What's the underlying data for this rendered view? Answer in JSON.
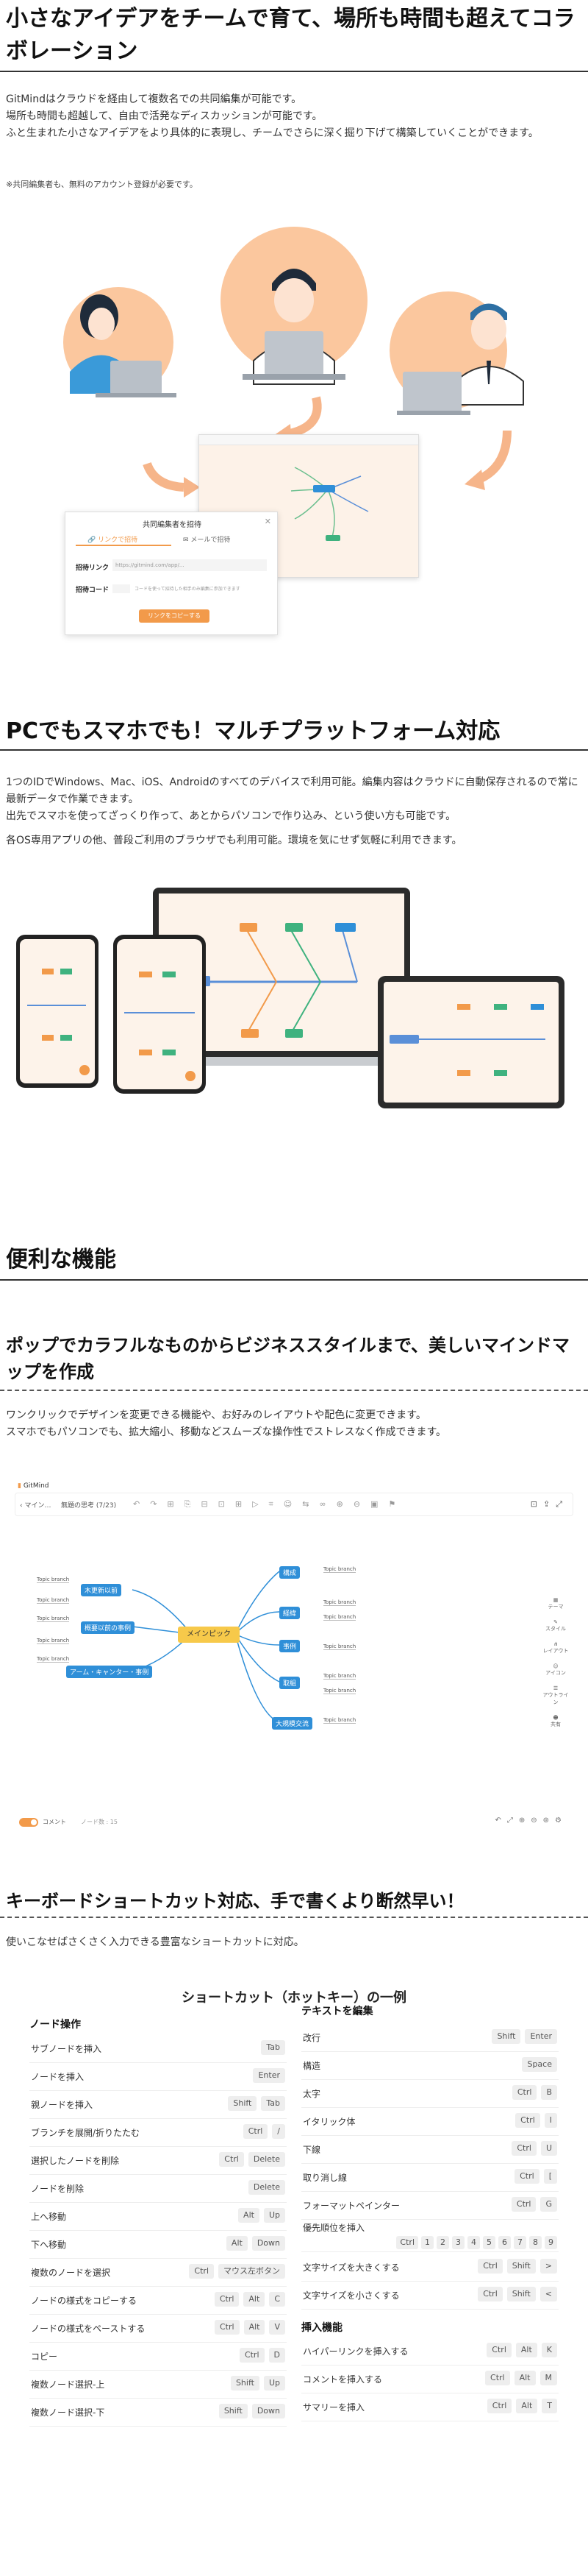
{
  "section1": {
    "title": "小さなアイデアをチームで育て、場所も時間も超えてコラボレーション",
    "paragraph": [
      "GitMindはクラウドを経由して複数名での共同編集が可能です。",
      "場所も時間も超越して、自由で活発なディスカッションが可能です。",
      "ふと生まれた小さなアイデアをより具体的に表現し、チームでさらに深く掘り下げて構築していくことができます。"
    ],
    "note": "※共同編集者も、無料のアカウント登録が必要です。",
    "invite_dialog": {
      "title": "共同編集者を招待",
      "tab_link": "リンクで招待",
      "tab_email": "メールで招待",
      "link_label": "招待リンク",
      "link_value": "https://gitmind.com/app/...",
      "code_label": "招待コード",
      "code_hint": "コードを使って招待した相手のみ編集に参加できます",
      "copy_button": "リンクをコピーする"
    }
  },
  "section2": {
    "title": "PCでもスマホでも！マルチプラットフォーム対応",
    "paragraph": [
      "1つのIDでWindows、Mac、iOS、Androidのすべてのデバイスで利用可能。編集内容はクラウドに自動保存されるので常に最新データで作業できます。",
      "出先でスマホを使ってざっくり作って、あとからパソコンで作り込み、という使い方も可能です。",
      "各OS専用アプリの他、普段ご利用のブラウザでも利用可能。環境を気にせず気軽に利用できます。"
    ]
  },
  "section3": {
    "title": "便利な機能"
  },
  "feature1": {
    "title": "ポップでカラフルなものからビジネススタイルまで、美しいマインドマップを作成",
    "paragraph": [
      "ワンクリックでデザインを変更できる機能や、お好みのレイアウトや配色に変更できます。",
      "スマホでもパソコンでも、拡大縮小、移動などスムーズな操作性でストレスなく作成できます。"
    ],
    "app": {
      "brand": "GitMind",
      "back": "マイン…",
      "doc_title": "無題の思考 (7/23)",
      "center_topic": "メインピック",
      "toggle_label": "コメント",
      "node_count": "ノード数 : 15",
      "right_tools": [
        "テーマ",
        "スタイル",
        "レイアウト",
        "アイコン",
        "アウトライン",
        "共有"
      ],
      "left_nodes": [
        "木更新以前",
        "概要以前の事例",
        "アーム・キャンター・事例"
      ],
      "right_nodes": [
        "構成",
        "経緯",
        "事例",
        "取組",
        "大規模交流"
      ],
      "topic_label": "Topic branch"
    }
  },
  "feature2": {
    "title": "キーボードショートカット対応、手で書くより断然早い！",
    "paragraph": "使いこなせばさくさく入力できる豊富なショートカットに対応。",
    "table_title": "ショートカット（ホットキー）の一例",
    "left_category": "ノード操作",
    "left_rows": [
      {
        "label": "サブノードを挿入",
        "keys": [
          "Tab"
        ]
      },
      {
        "label": "ノードを挿入",
        "keys": [
          "Enter"
        ]
      },
      {
        "label": "親ノードを挿入",
        "keys": [
          "Shift",
          "Tab"
        ]
      },
      {
        "label": "ブランチを展開/折りたたむ",
        "keys": [
          "Ctrl",
          "/"
        ]
      },
      {
        "label": "選択したノードを削除",
        "keys": [
          "Ctrl",
          "Delete"
        ]
      },
      {
        "label": "ノードを削除",
        "keys": [
          "Delete"
        ]
      },
      {
        "label": "上へ移動",
        "keys": [
          "Alt",
          "Up"
        ]
      },
      {
        "label": "下へ移動",
        "keys": [
          "Alt",
          "Down"
        ]
      },
      {
        "label": "複数のノードを選択",
        "keys": [
          "Ctrl",
          "マウス左ボタン"
        ]
      },
      {
        "label": "ノードの様式をコピーする",
        "keys": [
          "Ctrl",
          "Alt",
          "C"
        ]
      },
      {
        "label": "ノードの様式をペーストする",
        "keys": [
          "Ctrl",
          "Alt",
          "V"
        ]
      },
      {
        "label": "コピー",
        "keys": [
          "Ctrl",
          "D"
        ]
      },
      {
        "label": "複数ノード選択-上",
        "keys": [
          "Shift",
          "Up"
        ]
      },
      {
        "label": "複数ノード選択-下",
        "keys": [
          "Shift",
          "Down"
        ]
      }
    ],
    "right_category": "テキストを編集",
    "right_rows": [
      {
        "label": "改行",
        "keys": [
          "Shift",
          "Enter"
        ]
      },
      {
        "label": "構造",
        "keys": [
          "Space"
        ]
      },
      {
        "label": "太字",
        "keys": [
          "Ctrl",
          "B"
        ]
      },
      {
        "label": "イタリック体",
        "keys": [
          "Ctrl",
          "I"
        ]
      },
      {
        "label": "下線",
        "keys": [
          "Ctrl",
          "U"
        ]
      },
      {
        "label": "取り消し線",
        "keys": [
          "Ctrl",
          "["
        ]
      },
      {
        "label": "フォーマットペインター",
        "keys": [
          "Ctrl",
          "G"
        ]
      }
    ],
    "priority_label": "優先順位を挿入",
    "priority_keys": [
      "Ctrl",
      "1",
      "2",
      "3",
      "4",
      "5",
      "6",
      "7",
      "8",
      "9"
    ],
    "right_rows2": [
      {
        "label": "文字サイズを大きくする",
        "keys": [
          "Ctrl",
          "Shift",
          ">"
        ]
      },
      {
        "label": "文字サイズを小さくする",
        "keys": [
          "Ctrl",
          "Shift",
          "<"
        ]
      }
    ],
    "insert_category": "挿入機能",
    "insert_rows": [
      {
        "label": "ハイパーリンクを挿入する",
        "keys": [
          "Ctrl",
          "Alt",
          "K"
        ]
      },
      {
        "label": "コメントを挿入する",
        "keys": [
          "Ctrl",
          "Alt",
          "M"
        ]
      },
      {
        "label": "サマリーを挿入",
        "keys": [
          "Ctrl",
          "Alt",
          "T"
        ]
      }
    ]
  },
  "colors": {
    "orange": "#f29a4a",
    "peach": "#fbc79e",
    "green": "#3fb27f",
    "blue": "#2f8fd8"
  }
}
